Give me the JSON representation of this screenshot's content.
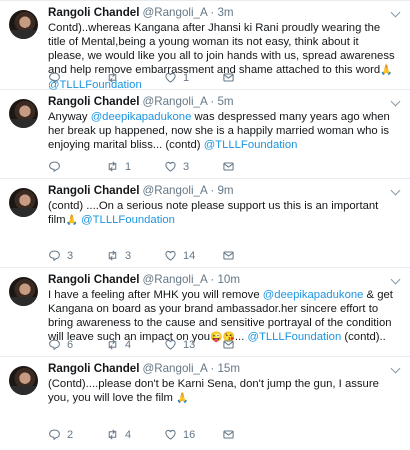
{
  "tweets": [
    {
      "name": "Rangoli Chandel",
      "handle": "@Rangoli_A",
      "sep": "·",
      "time": "3m",
      "segments": [
        {
          "text": "Contd)..whereas Kangana after Jhansi ki Rani proudly wearing the title of Mental,being a young woman its not easy, think about it please, we would like you all to join hands with us, spread awareness and help remove embarrassment and shame attached to this word"
        },
        {
          "text": "🙏",
          "emoji": true
        },
        {
          "text": " "
        },
        {
          "text": "@TLLLFoundation",
          "mention": true
        }
      ],
      "replies": "",
      "retweets": "",
      "likes": "1"
    },
    {
      "name": "Rangoli Chandel",
      "handle": "@Rangoli_A",
      "sep": "·",
      "time": "5m",
      "segments": [
        {
          "text": "Anyway "
        },
        {
          "text": "@deepikapadukone",
          "mention": true
        },
        {
          "text": " was despressed many years ago when her break up happened, now she is a happily married woman who is enjoying marital bliss... (contd) "
        },
        {
          "text": "@TLLLFoundation",
          "mention": true
        }
      ],
      "replies": "",
      "retweets": "1",
      "likes": "3"
    },
    {
      "name": "Rangoli Chandel",
      "handle": "@Rangoli_A",
      "sep": "·",
      "time": "9m",
      "segments": [
        {
          "text": "(contd) ....On a serious note please support us this is an important film"
        },
        {
          "text": "🙏",
          "emoji": true
        },
        {
          "text": " "
        },
        {
          "text": "@TLLLFoundation",
          "mention": true
        }
      ],
      "replies": "3",
      "retweets": "3",
      "likes": "14"
    },
    {
      "name": "Rangoli Chandel",
      "handle": "@Rangoli_A",
      "sep": "·",
      "time": "10m",
      "segments": [
        {
          "text": "I have a feeling after MHK you will remove "
        },
        {
          "text": "@deepikapadukone",
          "mention": true
        },
        {
          "text": " & get Kangana on board as your brand ambassador.her sincere effort to bring awareness to the cause and sensitive portrayal of the condition will leave such an impact on you"
        },
        {
          "text": "😜😘",
          "emoji": true
        },
        {
          "text": "... "
        },
        {
          "text": "@TLLLFoundation",
          "mention": true
        },
        {
          "text": " (contd).."
        }
      ],
      "replies": "6",
      "retweets": "4",
      "likes": "13"
    },
    {
      "name": "Rangoli Chandel",
      "handle": "@Rangoli_A",
      "sep": "·",
      "time": "15m",
      "segments": [
        {
          "text": "(Contd)....please don't be Karni Sena, don't jump the gun, I assure you, you will love the film "
        },
        {
          "text": "🙏",
          "emoji": true
        }
      ],
      "replies": "2",
      "retweets": "4",
      "likes": "16"
    }
  ]
}
